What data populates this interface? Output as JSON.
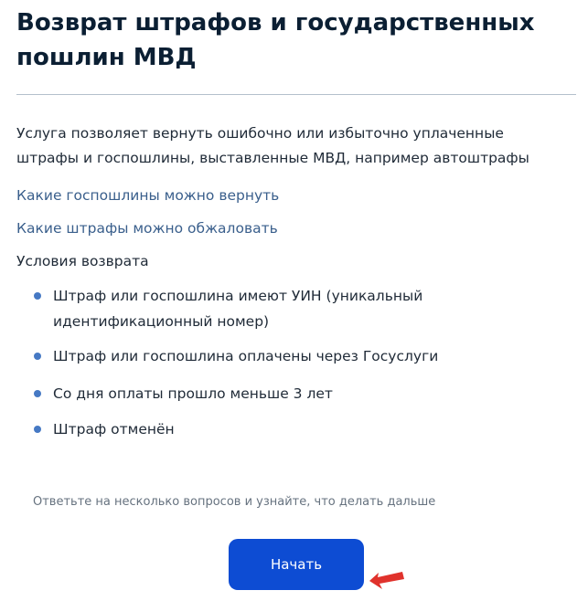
{
  "header": {
    "title": "Возврат штрафов и государственных пошлин МВД"
  },
  "intro": {
    "text": "Услуга позволяет вернуть ошибочно или избыточно уплаченные штрафы и госпошлины, выставленные МВД, например автоштрафы"
  },
  "links": [
    {
      "label": "Какие госпошлины можно вернуть"
    },
    {
      "label": "Какие штрафы можно обжаловать"
    }
  ],
  "conditions": {
    "title": "Условия возврата",
    "items": [
      {
        "text": "Штраф или госпошлина имеют УИН (уникальный идентификационный номер)"
      },
      {
        "text": "Штраф или госпошлина оплачены через Госуслуги"
      },
      {
        "text": "Со дня оплаты прошло меньше 3 лет"
      },
      {
        "text": "Штраф отменён"
      }
    ]
  },
  "hint": {
    "text": "Ответьте на несколько вопросов и узнайте, что делать дальше"
  },
  "start_button": {
    "label": "Начать"
  },
  "colors": {
    "primary_button": "#0d4cd3",
    "link": "#3a5f8c",
    "bullet": "#4679c4",
    "arrow": "#e0322c"
  }
}
